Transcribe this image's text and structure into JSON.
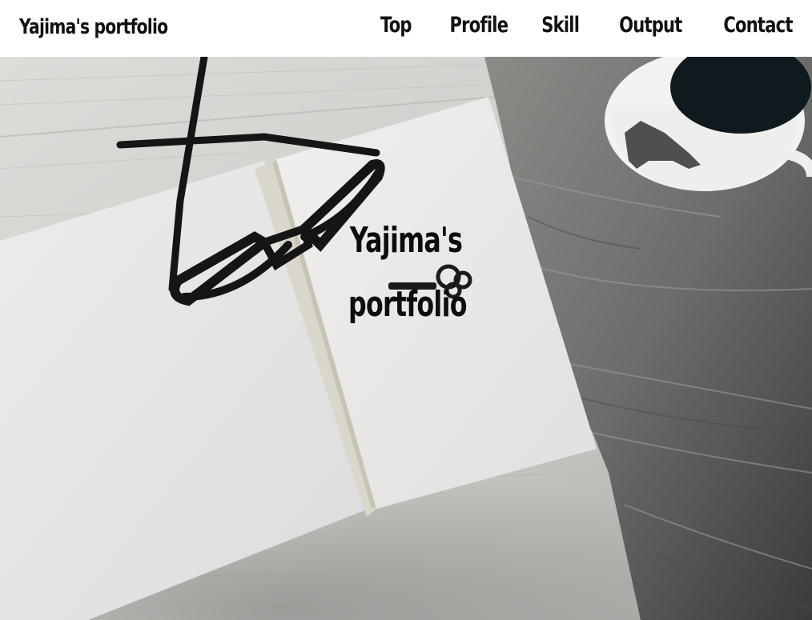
{
  "header": {
    "site_title": "Yajima's portfolio",
    "nav": [
      {
        "label": "Top"
      },
      {
        "label": "Profile"
      },
      {
        "label": "Skill"
      },
      {
        "label": "Output"
      },
      {
        "label": "Contact"
      }
    ]
  },
  "hero": {
    "title": "Yajima's portfolio",
    "background_image": "notebook-glasses-coffee-photo"
  },
  "colors": {
    "text": "#111111",
    "header_bg": "#ffffff"
  }
}
